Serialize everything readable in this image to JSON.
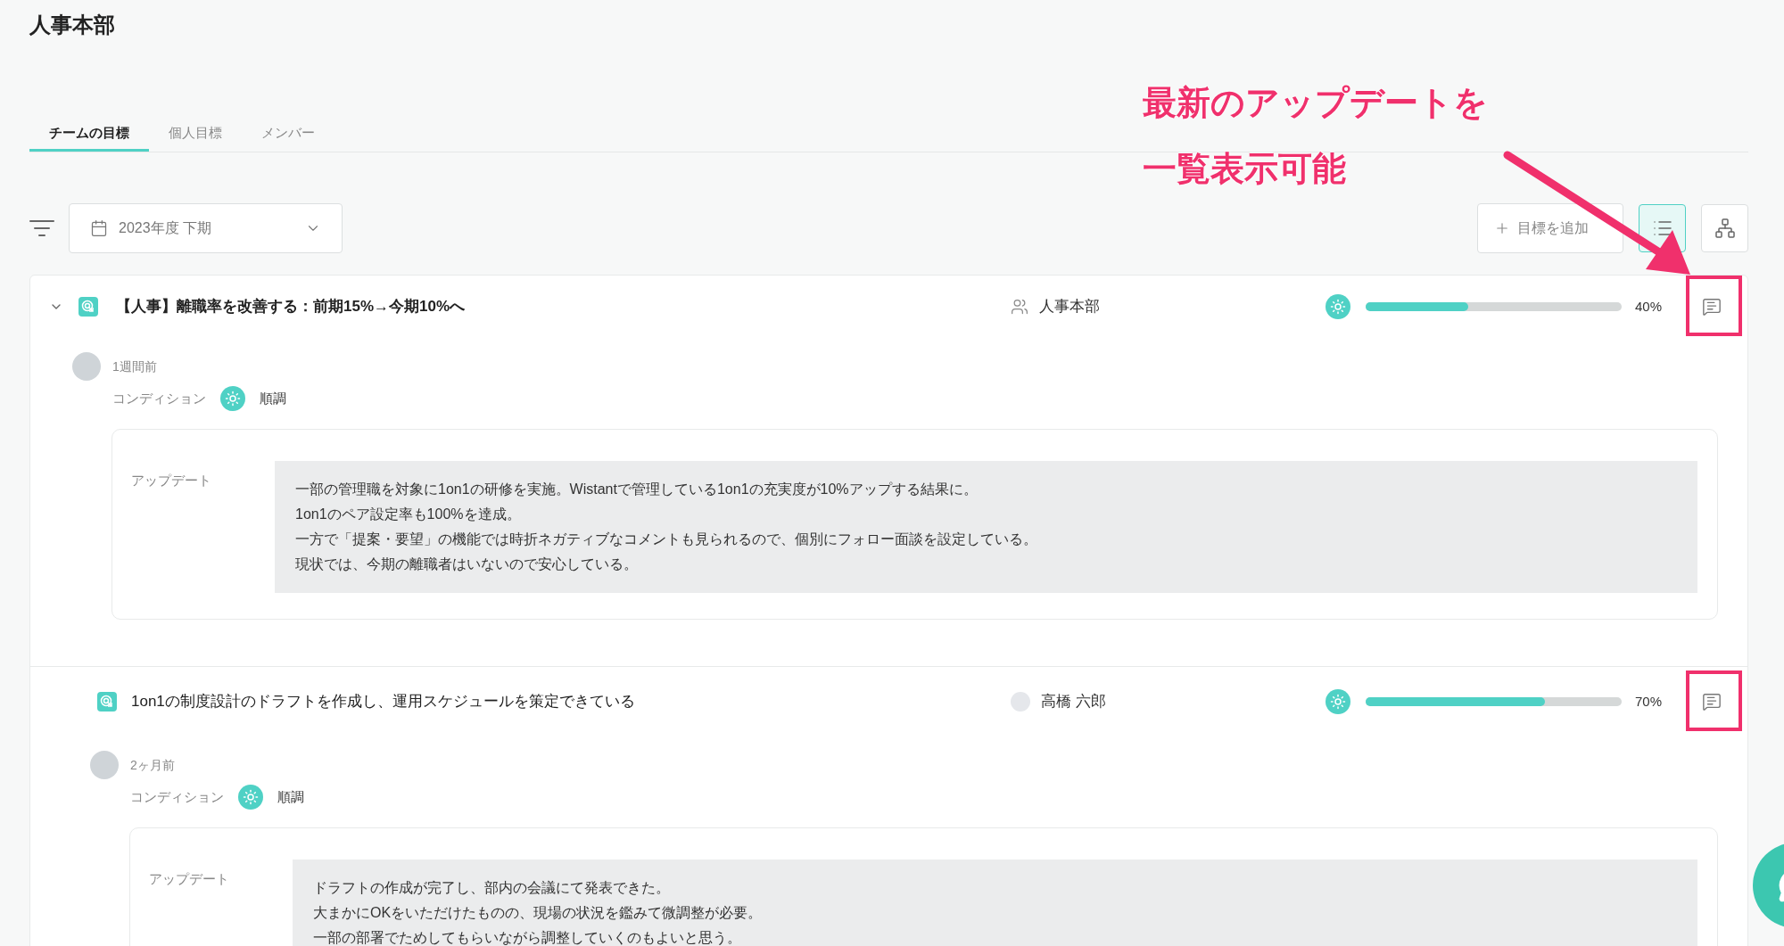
{
  "page_title": "人事本部",
  "tabs": [
    {
      "label": "チームの目標",
      "selected": true
    },
    {
      "label": "個人目標",
      "selected": false
    },
    {
      "label": "メンバー",
      "selected": false
    }
  ],
  "period_select": {
    "value": "2023年度 下期"
  },
  "add_goal_button": {
    "label": "目標を追加"
  },
  "view_toggles": [
    {
      "kind": "list",
      "selected": true
    },
    {
      "kind": "tree",
      "selected": false
    }
  ],
  "goals": [
    {
      "title": "【人事】離職率を改善する：前期15%→今期10%へ",
      "expanded": true,
      "owner": {
        "kind": "team",
        "name": "人事本部"
      },
      "level": 0.4,
      "progress": "40%",
      "highlighted": true,
      "update": {
        "time": "1週間前",
        "condition_label": "コンディション",
        "condition": {
          "kind": "good",
          "label": "順調"
        },
        "label": "アップデート",
        "lines": [
          "一部の管理職を対象に1on1の研修を実施。Wistantで管理している1on1の充実度が10%アップする結果に。",
          "1on1のペア設定率も100%を達成。",
          "一方で「提案・要望」の機能では時折ネガティブなコメントも見られるので、個別にフォロー面談を設定している。",
          "現状では、今期の離職者はいないので安心している。"
        ]
      },
      "children": [
        {
          "title": "1on1の制度設計のドラフトを作成し、運用スケジュールを策定できている",
          "owner": {
            "kind": "person",
            "name": "高橋 六郎"
          },
          "level": 0.7,
          "progress": "70%",
          "highlighted": true,
          "update": {
            "time": "2ヶ月前",
            "condition_label": "コンディション",
            "condition": {
              "kind": "good",
              "label": "順調"
            },
            "label": "アップデート",
            "lines": [
              "ドラフトの作成が完了し、部内の会議にて発表できた。",
              "大まかにOKをいただけたものの、現場の状況を鑑みて微調整が必要。",
              "一部の部署でためしてもらいながら調整していくのもよいと思う。"
            ]
          }
        }
      ]
    }
  ],
  "annotation": {
    "lines": [
      "最新のアップデートを",
      "一覧表示可能"
    ]
  }
}
